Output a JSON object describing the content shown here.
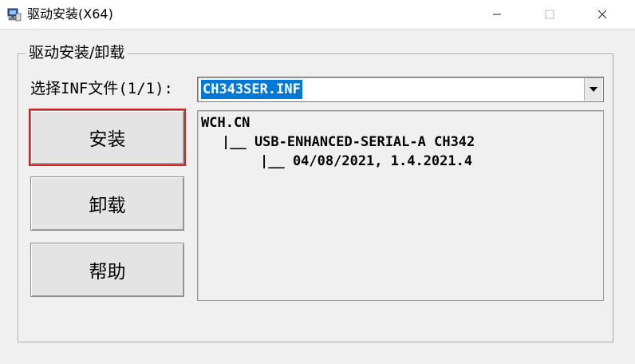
{
  "window": {
    "title": "驱动安装(X64)",
    "icon": "installer-app-icon",
    "controls": {
      "minimize": "minimize-icon",
      "maximize": "maximize-icon",
      "close": "close-icon"
    }
  },
  "group": {
    "legend": "驱动安装/卸载",
    "inf_label": "选择INF文件(1/1):",
    "inf_selected": "CH343SER.INF",
    "buttons": {
      "install": "安装",
      "uninstall": "卸载",
      "help": "帮助"
    },
    "info_lines": [
      "WCH.CN",
      "|__ USB-ENHANCED-SERIAL-A CH342",
      "|__ 04/08/2021, 1.4.2021.4"
    ]
  },
  "colors": {
    "selection_bg": "#0078d7",
    "focus_highlight": "#e02020",
    "window_bg": "#f0f0f0"
  }
}
